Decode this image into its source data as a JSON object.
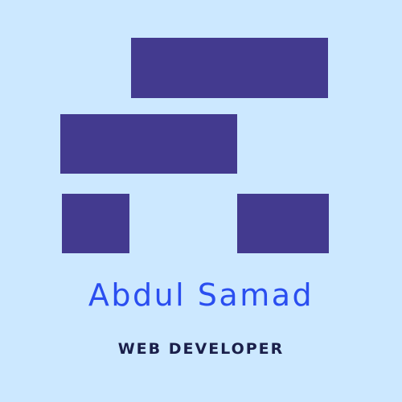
{
  "brand": {
    "name": "Abdul Samad",
    "tagline": "WEB DEVELOPER"
  },
  "colors": {
    "background": "#cce8ff",
    "logo_blocks": "#433a8f",
    "name": "#2a4ef0",
    "tagline": "#1a1f4a"
  }
}
